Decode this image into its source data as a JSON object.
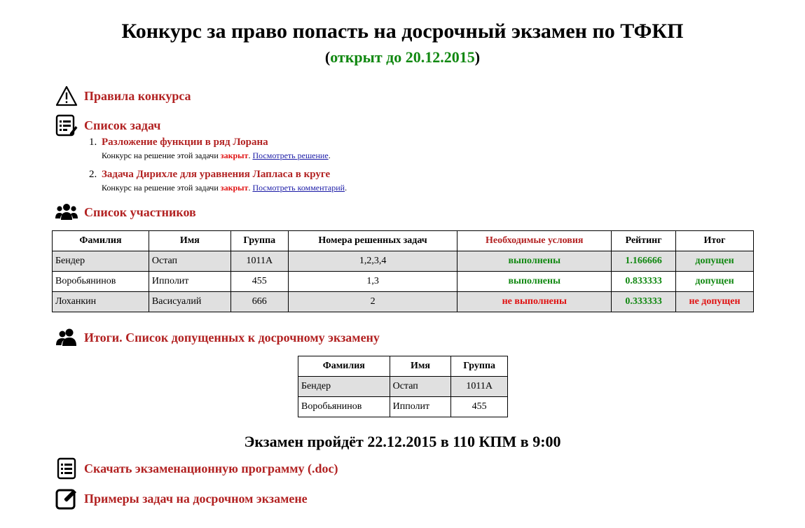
{
  "header": {
    "title": "Конкурс за право попасть на досрочный экзамен по ТФКП",
    "subtitle_open": "(",
    "subtitle_text": "открыт до 20.12.2015",
    "subtitle_close": ")"
  },
  "sections": {
    "rules": "Правила конкурса",
    "tasks": "Список задач",
    "participants": "Список участников",
    "results": "Итоги. Список допущенных к досрочному экзамену",
    "download": "Скачать экзаменационную программу (.doc)",
    "examples": "Примеры задач на досрочном экзамене"
  },
  "tasks": [
    {
      "num": "1.",
      "title": "Разложение функции в ряд Лорана",
      "note_prefix": "Конкурс на решение этой задачи ",
      "status": "закрыт",
      "sep": ". ",
      "link": "Посмотреть решение",
      "end": "."
    },
    {
      "num": "2.",
      "title": "Задача Дирихле для уравнения Лапласа в круге",
      "note_prefix": "Конкурс на решение этой задачи ",
      "status": "закрыт",
      "sep": ". ",
      "link": "Посмотреть комментарий",
      "end": "."
    }
  ],
  "participants_table": {
    "headers": [
      "Фамилия",
      "Имя",
      "Группа",
      "Номера решенных задач",
      "Необходимые условия",
      "Рейтинг",
      "Итог"
    ],
    "rows": [
      [
        "Бендер",
        "Остап",
        "1011А",
        "1,2,3,4",
        "выполнены",
        "1.166666",
        "допущен"
      ],
      [
        "Воробьянинов",
        "Ипполит",
        "455",
        "1,3",
        "выполнены",
        "0.833333",
        "допущен"
      ],
      [
        "Лоханкин",
        "Васисуалий",
        "666",
        "2",
        "не выполнены",
        "0.333333",
        "не допущен"
      ]
    ]
  },
  "admitted_table": {
    "headers": [
      "Фамилия",
      "Имя",
      "Группа"
    ],
    "rows": [
      [
        "Бендер",
        "Остап",
        "1011А"
      ],
      [
        "Воробьянинов",
        "Ипполит",
        "455"
      ]
    ]
  },
  "exam_info": "Экзамен пройдёт 22.12.2015 в 110 КПМ в 9:00",
  "colors": {
    "accent": "#b22222",
    "green": "#118811",
    "red": "#e01010",
    "link": "#1a1aa6"
  }
}
